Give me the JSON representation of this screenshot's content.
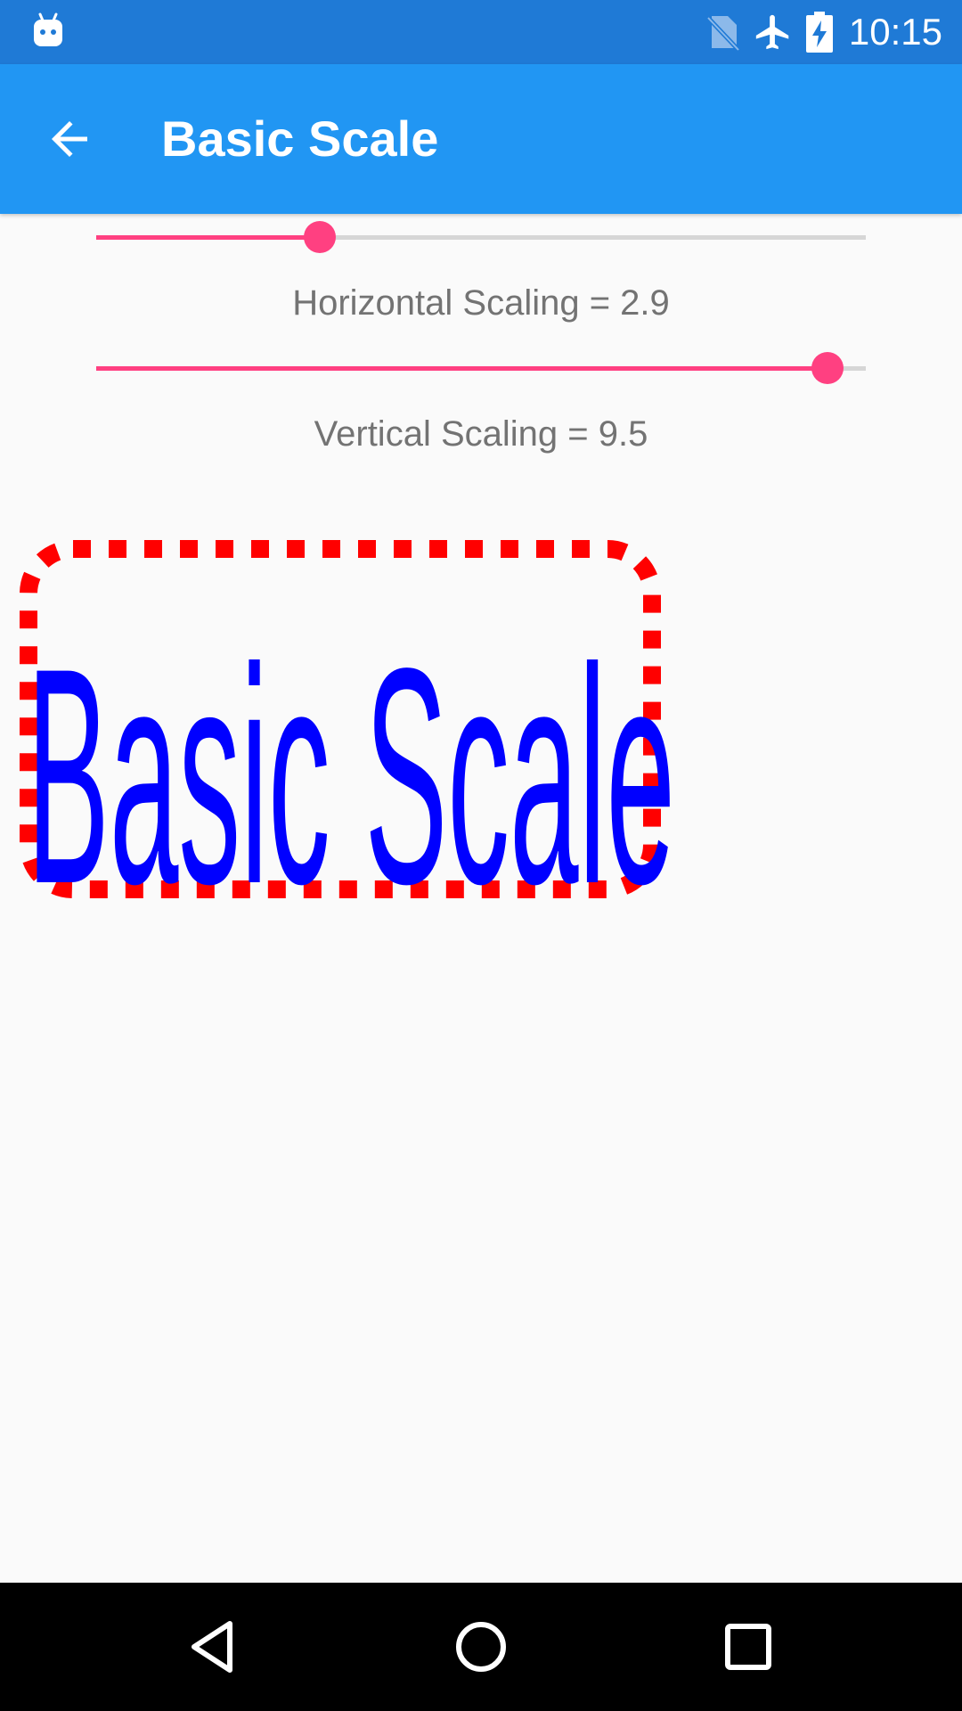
{
  "status_bar": {
    "time": "10:15",
    "icons": [
      "android-robot-icon",
      "no-sim-icon",
      "airplane-mode-icon",
      "battery-charging-icon"
    ]
  },
  "app_bar": {
    "title": "Basic Scale",
    "back_icon": "arrow-back-icon"
  },
  "sliders": [
    {
      "label": "Horizontal Scaling = 2.9",
      "value": 2.9,
      "min": 0,
      "max": 10
    },
    {
      "label": "Vertical Scaling = 9.5",
      "value": 9.5,
      "min": 0,
      "max": 10
    }
  ],
  "demo": {
    "text": "Basic Scale",
    "text_color": "#0000ff",
    "frame_color": "#ff0000"
  },
  "nav_bar": {
    "buttons": [
      "back-triangle-icon",
      "home-circle-icon",
      "recents-square-icon"
    ]
  },
  "colors": {
    "status_bar": "#1f7ad6",
    "app_bar": "#2196f3",
    "accent": "#ff4081",
    "background": "#fafafa"
  }
}
